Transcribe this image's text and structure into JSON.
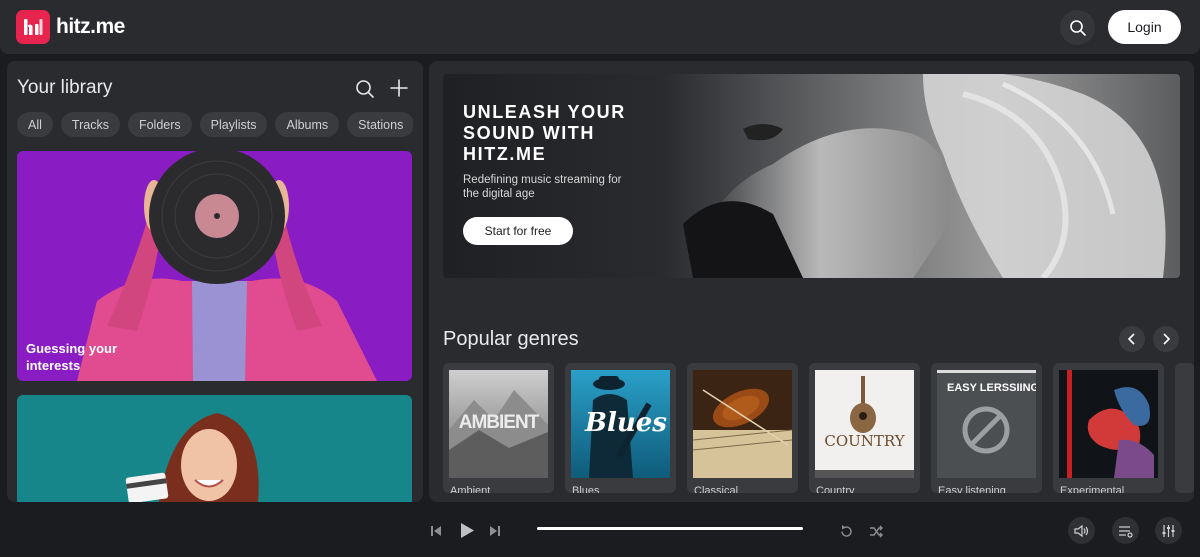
{
  "header": {
    "logo_text": "hitz.me",
    "login_label": "Login"
  },
  "library": {
    "title": "Your library",
    "chips": [
      "All",
      "Tracks",
      "Folders",
      "Playlists",
      "Albums",
      "Stations"
    ],
    "cards": [
      {
        "label": "Guessing your interests"
      },
      {
        "label": ""
      }
    ]
  },
  "hero": {
    "title": "UNLEASH YOUR SOUND WITH HITZ.ME",
    "subtitle": "Redefining music streaming for the digital age",
    "cta_label": "Start for free"
  },
  "genres": {
    "title": "Popular genres",
    "items": [
      {
        "name": "Ambient",
        "art_text": "AMBIENT"
      },
      {
        "name": "Blues",
        "art_text": "Blues"
      },
      {
        "name": "Classical",
        "art_text": ""
      },
      {
        "name": "Country",
        "art_text": "COUNTRY"
      },
      {
        "name": "Easy listening",
        "art_text": "EASY LERSSIING"
      },
      {
        "name": "Experimental",
        "art_text": ""
      }
    ]
  },
  "player": {
    "progress_fraction": 1.0
  },
  "colors": {
    "brand": "#e6244e",
    "background": "#1b1c1f",
    "panel": "#2a2b2f"
  }
}
